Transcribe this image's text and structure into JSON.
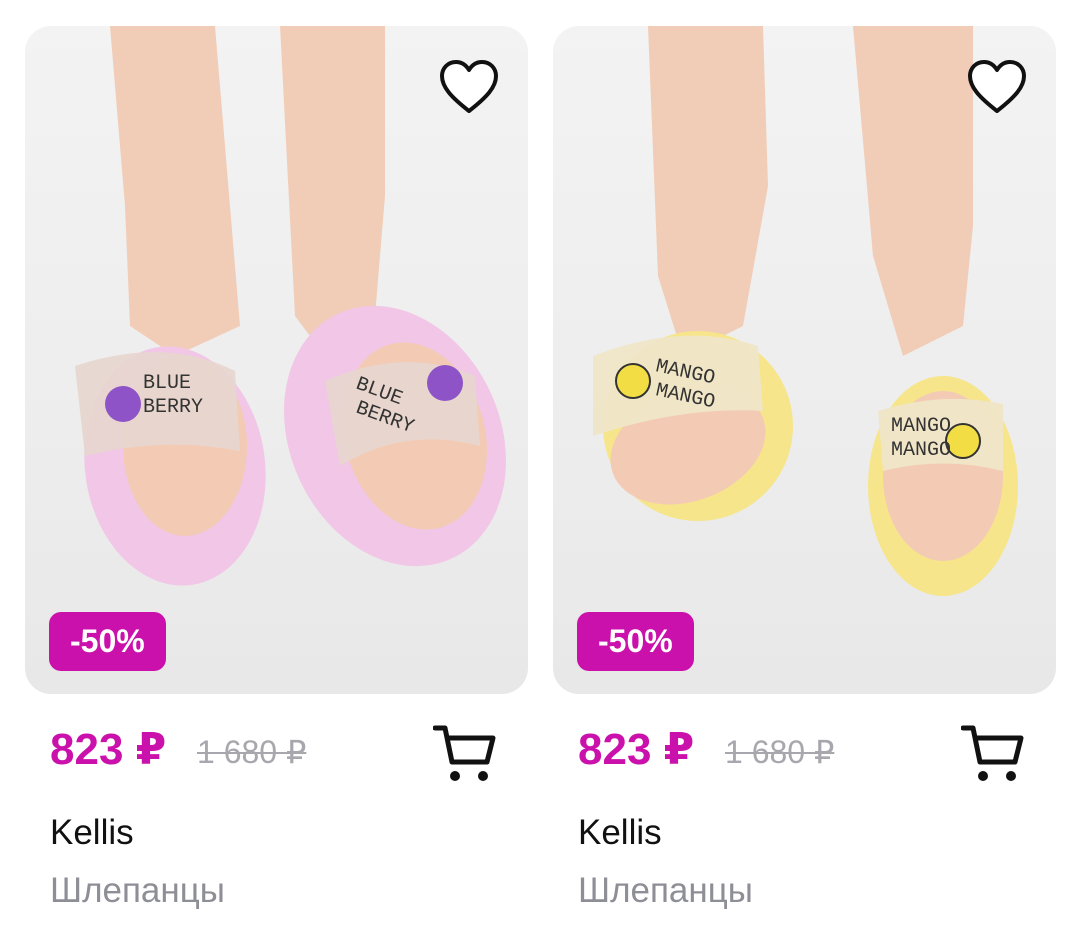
{
  "theme": {
    "accent": "#cb11ab",
    "old_price": "#a7a7ad",
    "muted": "#8e8e96"
  },
  "products": [
    {
      "badge": "-50%",
      "price": "823 ₽",
      "old_price": "1 680 ₽",
      "brand": "Kellis",
      "category": "Шлепанцы",
      "strap_text": [
        "BLUE",
        "BERRY"
      ],
      "sole_color": "#f1c6e6",
      "icons": {
        "favorite": "heart-icon",
        "cart": "cart-icon"
      }
    },
    {
      "badge": "-50%",
      "price": "823 ₽",
      "old_price": "1 680 ₽",
      "brand": "Kellis",
      "category": "Шлепанцы",
      "strap_text": [
        "MANGO",
        "MANGO"
      ],
      "sole_color": "#f6e58a",
      "icons": {
        "favorite": "heart-icon",
        "cart": "cart-icon"
      }
    }
  ]
}
